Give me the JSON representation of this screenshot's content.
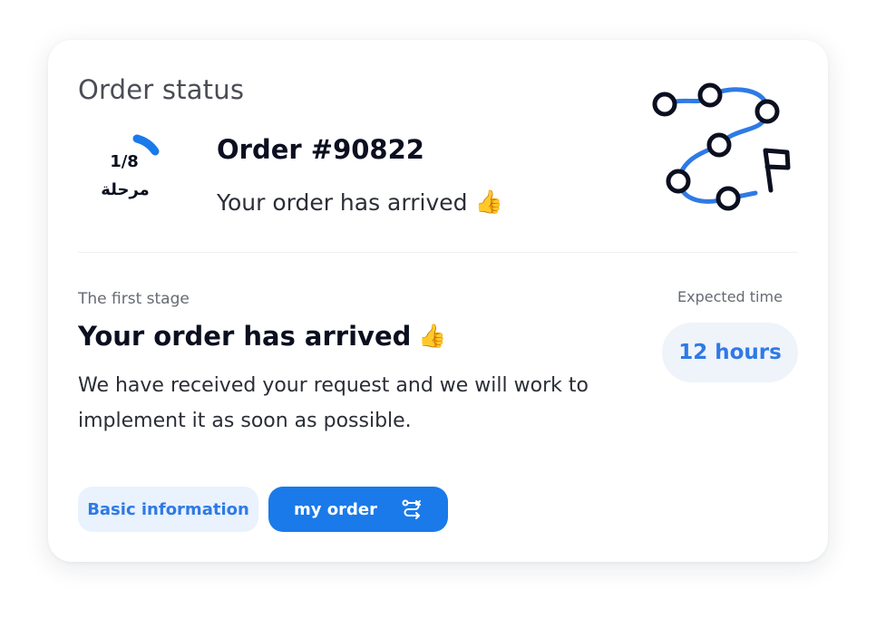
{
  "header": {
    "title": "Order status"
  },
  "progress": {
    "current": 1,
    "total": 8,
    "count_text": "1/8",
    "stage_word": "مرحلة"
  },
  "order": {
    "number": "Order #90822",
    "message": "Your order has arrived"
  },
  "stage": {
    "label": "The first stage",
    "title": "Your order has arrived",
    "description": "We have received your request and we will work to implement it as soon as possible."
  },
  "expected": {
    "label": "Expected time",
    "value": "12 hours"
  },
  "buttons": {
    "basic_label": "Basic information",
    "order_label": "my order"
  },
  "icons": {
    "thumb": "👍",
    "route_illustration": "route-map-icon",
    "route_button_icon": "route-icon"
  },
  "colors": {
    "accent": "#1a7ae9",
    "accent_text": "#2f7ae5",
    "pill_bg": "#eff3fa",
    "ink": "#0b0f1f"
  }
}
